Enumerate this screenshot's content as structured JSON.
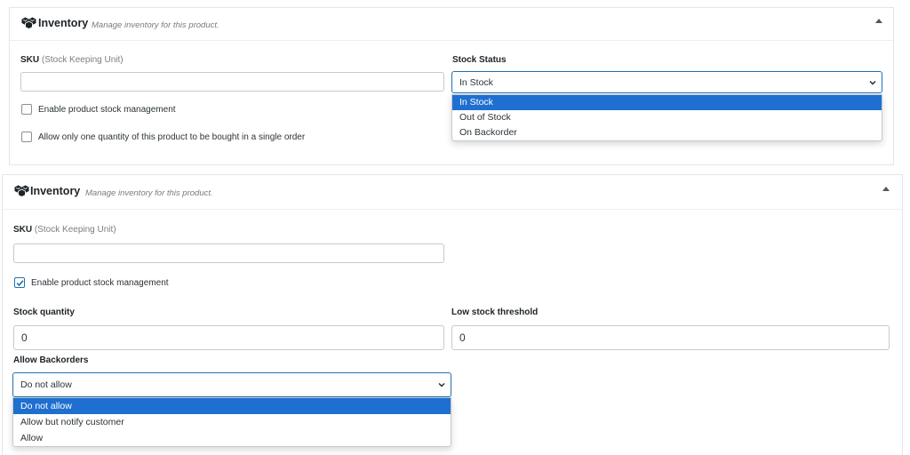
{
  "colors": {
    "accent": "#2271b1",
    "option_selected_bg": "#1f6fd1"
  },
  "panel1": {
    "header": {
      "icon": "boxes-icon",
      "title": "Inventory",
      "description": "Manage inventory for this product."
    },
    "sku": {
      "label": "SKU",
      "hint": "(Stock Keeping Unit)",
      "value": ""
    },
    "stock_status": {
      "label": "Stock Status",
      "selected": "In Stock",
      "options": [
        "In Stock",
        "Out of Stock",
        "On Backorder"
      ]
    },
    "manage_stock": {
      "label": "Enable product stock management",
      "checked": false
    },
    "sold_individually": {
      "label": "Allow only one quantity of this product to be bought in a single order",
      "checked": false
    }
  },
  "panel2": {
    "header": {
      "icon": "boxes-icon",
      "title": "Inventory",
      "description": "Manage inventory for this product."
    },
    "sku": {
      "label": "SKU",
      "hint": "(Stock Keeping Unit)",
      "value": ""
    },
    "manage_stock": {
      "label": "Enable product stock management",
      "checked": true
    },
    "stock_quantity": {
      "label": "Stock quantity",
      "value": "0"
    },
    "low_stock_threshold": {
      "label": "Low stock threshold",
      "value": "0"
    },
    "backorders": {
      "label": "Allow Backorders",
      "selected": "Do not allow",
      "options": [
        "Do not allow",
        "Allow but notify customer",
        "Allow"
      ]
    }
  }
}
